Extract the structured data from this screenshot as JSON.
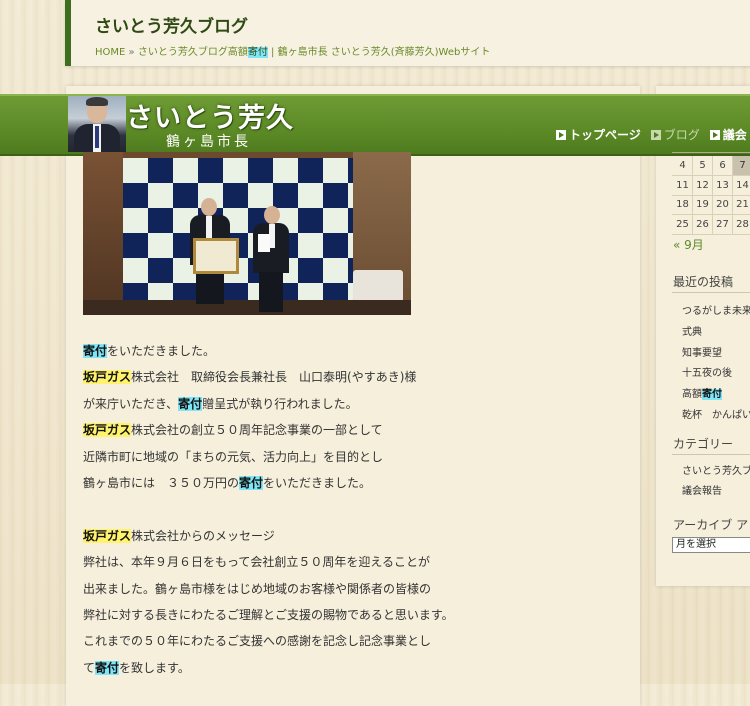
{
  "header": {
    "site_title": "さいとう芳久ブログ",
    "breadcrumb": {
      "home": "HOME",
      "sep": "»",
      "current_prefix": "さいとう芳久ブログ高額",
      "current_highlight": "寄付",
      "current_suffix": " | 鶴ヶ島市長 さいとう芳久(斉藤芳久)Webサイト"
    }
  },
  "banner": {
    "name": "さいとう芳久",
    "subtitle": "鶴ヶ島市長",
    "nav": [
      {
        "label": "トップページ"
      },
      {
        "label": "ブログ"
      },
      {
        "label": "議会"
      }
    ]
  },
  "article": {
    "lines": [
      [
        {
          "t": "寄付",
          "h": "blue"
        },
        {
          "t": "をいただきました。"
        }
      ],
      [
        {
          "t": "坂戸ガス",
          "h": "yellow"
        },
        {
          "t": "株式会社　取締役会長兼社長　山口泰明(やすあき)様"
        }
      ],
      [
        {
          "t": "が来庁いただき、"
        },
        {
          "t": "寄付",
          "h": "blue"
        },
        {
          "t": "贈呈式が執り行われました。"
        }
      ],
      [
        {
          "t": "坂戸ガス",
          "h": "yellow"
        },
        {
          "t": "株式会社の創立５０周年記念事業の一部として"
        }
      ],
      [
        {
          "t": "近隣市町に地域の「まちの元気、活力向上」を目的とし"
        }
      ],
      [
        {
          "t": "鶴ヶ島市には　３５０万円の"
        },
        {
          "t": "寄付",
          "h": "blue"
        },
        {
          "t": "をいただきました。"
        }
      ],
      [
        {
          "t": ""
        }
      ],
      [
        {
          "t": "坂戸ガス",
          "h": "yellow"
        },
        {
          "t": "株式会社からのメッセージ"
        }
      ],
      [
        {
          "t": "弊社は、本年９月６日をもって会社創立５０周年を迎えることが"
        }
      ],
      [
        {
          "t": "出来ました。鶴ヶ島市様をはじめ地域のお客様や関係者の皆様の"
        }
      ],
      [
        {
          "t": "弊社に対する長きにわたるご理解とご支援の賜物であると思います。"
        }
      ],
      [
        {
          "t": "これまでの５０年にわたるご支援への感謝を記念し記念事業とし"
        }
      ],
      [
        {
          "t": "て"
        },
        {
          "t": "寄付",
          "h": "blue"
        },
        {
          "t": "を致します。"
        }
      ]
    ]
  },
  "sidebar": {
    "calendar_rows": [
      [
        "4",
        "5",
        "6",
        "7"
      ],
      [
        "11",
        "12",
        "13",
        "14"
      ],
      [
        "18",
        "19",
        "20",
        "21"
      ],
      [
        "25",
        "26",
        "27",
        "28"
      ]
    ],
    "calendar_today": "7",
    "prev_month": "« 9月",
    "recent_heading": "最近の投稿",
    "recent_posts": [
      [
        {
          "t": "つるがしま未来"
        }
      ],
      [
        {
          "t": "式典"
        }
      ],
      [
        {
          "t": "知事要望"
        }
      ],
      [
        {
          "t": "十五夜の後"
        }
      ],
      [
        {
          "t": "高額"
        },
        {
          "t": "寄付",
          "h": "blue"
        }
      ],
      [
        {
          "t": "乾杯　かんぱい"
        }
      ]
    ],
    "category_heading": "カテゴリー",
    "categories": [
      "さいとう芳久ブ",
      "議会報告"
    ],
    "archive_heading": "アーカイブ ア",
    "archive_select": "月を選択"
  },
  "colors": {
    "brand_green": "#5c8a26",
    "highlight_blue": "#7ee6f7",
    "highlight_yellow": "#fff36e"
  }
}
